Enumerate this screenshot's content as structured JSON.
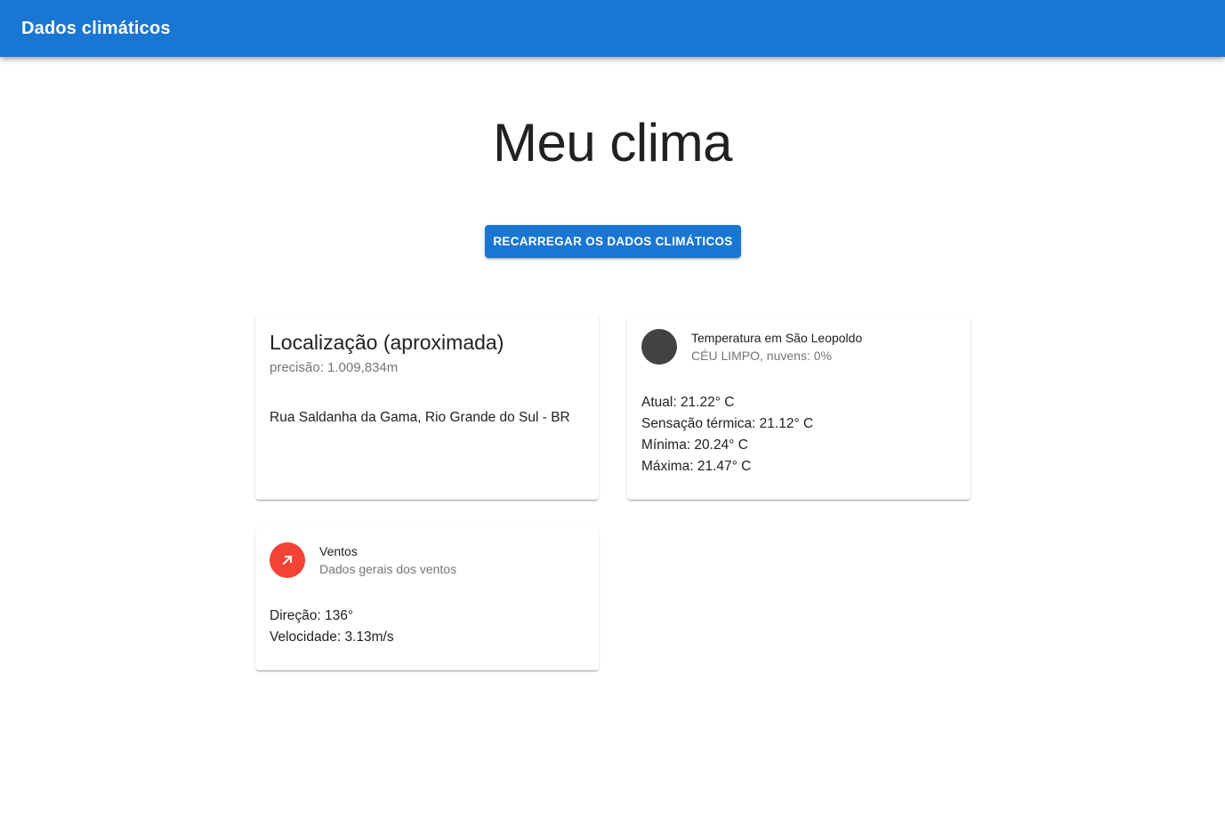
{
  "appbar": {
    "title": "Dados climáticos"
  },
  "main": {
    "title": "Meu clima",
    "reload_button_label": "RECARREGAR OS DADOS CLIMÁTICOS"
  },
  "location_card": {
    "title": "Localização (aproximada)",
    "subtitle": "precisão: 1.009,834m",
    "address": "Rua Saldanha da Gama, Rio Grande do Sul - BR"
  },
  "temperature_card": {
    "title": "Temperatura em São Leopoldo",
    "subtitle": "CÉU LIMPO, nuvens: 0%",
    "avatar_icon": "weather-icon",
    "lines": [
      "Atual: 21.22° C",
      "Sensação térmica: 21.12° C",
      "Mínima: 20.24° C",
      "Máxima: 21.47° C"
    ]
  },
  "wind_card": {
    "title": "Ventos",
    "subtitle": "Dados gerais dos ventos",
    "avatar_icon": "arrow-north-east-icon",
    "lines": [
      "Direção: 136°",
      "Velocidade: 3.13m/s"
    ]
  },
  "colors": {
    "primary": "#1976d2",
    "wind_avatar": "#f44336",
    "temp_avatar": "#424242"
  }
}
